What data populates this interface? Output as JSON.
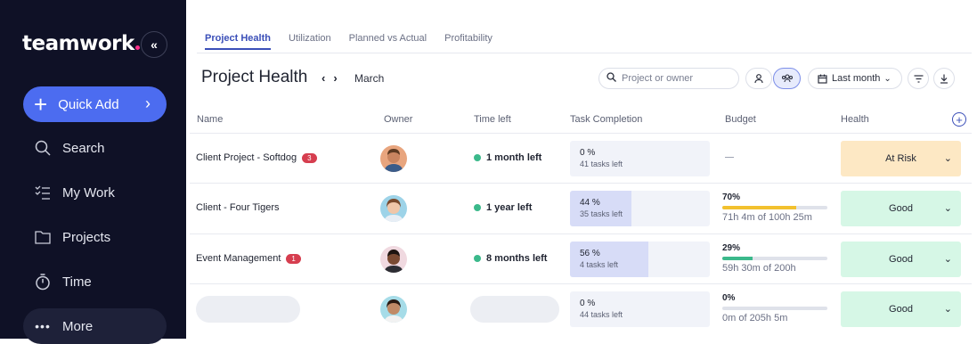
{
  "brand": {
    "name": "teamwork",
    "accent": "#ff2e8a"
  },
  "sidebar": {
    "quick_add": "Quick Add",
    "items": [
      {
        "label": "Search",
        "icon": "search-icon"
      },
      {
        "label": "My Work",
        "icon": "checklist-icon"
      },
      {
        "label": "Projects",
        "icon": "folder-icon"
      },
      {
        "label": "Time",
        "icon": "stopwatch-icon"
      },
      {
        "label": "More",
        "icon": "dots-icon"
      }
    ]
  },
  "tabs": [
    "Project Health",
    "Utilization",
    "Planned vs Actual",
    "Profitability"
  ],
  "header": {
    "title": "Project Health",
    "month": "March",
    "search_placeholder": "Project or owner",
    "period": "Last month"
  },
  "columns": [
    "Name",
    "Owner",
    "Time left",
    "Task Completion",
    "Budget",
    "Health"
  ],
  "rows": [
    {
      "name": "Client Project - Softdog",
      "badge": "3",
      "time_left": "1 month left",
      "task_pct": "0 %",
      "task_sub": "41 tasks left",
      "task_fraction": 0.0,
      "budget": null,
      "health": "At Risk",
      "health_color": "#fde8c4"
    },
    {
      "name": "Client - Four Tigers",
      "badge": "",
      "time_left": "1 year left",
      "task_pct": "44 %",
      "task_sub": "35 tasks left",
      "task_fraction": 0.44,
      "budget": {
        "pct": "70%",
        "sub": "71h 4m of 100h 25m",
        "fraction": 0.7,
        "color": "#f2c12e"
      },
      "health": "Good",
      "health_color": "#d6f7e6"
    },
    {
      "name": "Event Management",
      "badge": "1",
      "time_left": "8 months left",
      "task_pct": "56 %",
      "task_sub": "4 tasks left",
      "task_fraction": 0.56,
      "budget": {
        "pct": "29%",
        "sub": "59h 30m of 200h",
        "fraction": 0.29,
        "color": "#3bb98b"
      },
      "health": "Good",
      "health_color": "#d6f7e6"
    },
    {
      "name": "",
      "badge": "",
      "time_left": "",
      "task_pct": "0 %",
      "task_sub": "44 tasks left",
      "task_fraction": 0.0,
      "budget": {
        "pct": "0%",
        "sub": "0m of 205h 5m",
        "fraction": 0.0,
        "color": "#3bb98b"
      },
      "health": "Good",
      "health_color": "#d6f7e6"
    }
  ]
}
